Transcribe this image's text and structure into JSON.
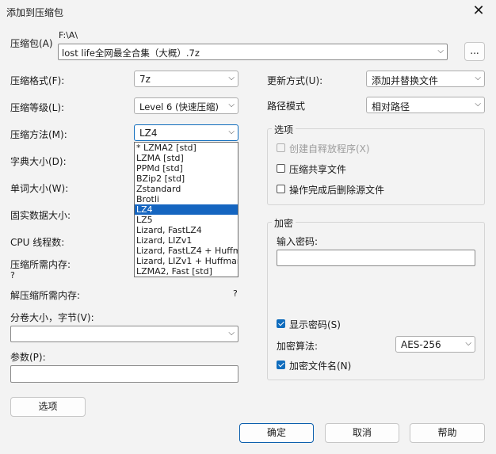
{
  "window": {
    "title": "添加到压缩包"
  },
  "archive": {
    "label": "压缩包(A)",
    "path": "F:\\A\\",
    "filename": "lost life全网最全合集（大概）.7z",
    "browse": "..."
  },
  "left": {
    "format_label": "压缩格式(F):",
    "format_value": "7z",
    "level_label": "压缩等级(L):",
    "level_value": "Level 6 (快速压缩)",
    "method_label": "压缩方法(M):",
    "method_value": "LZ4",
    "dict_label": "字典大小(D):",
    "word_label": "单词大小(W):",
    "solid_label": "固实数据大小:",
    "cpu_label": "CPU 线程数:",
    "memc_label": "压缩所需内存:",
    "memc_value": "?",
    "memd_label": "解压缩所需内存:",
    "memd_value": "?",
    "split_label": "分卷大小，字节(V):",
    "split_value": "",
    "params_label": "参数(P):",
    "params_value": "",
    "options_btn": "选项"
  },
  "method_dropdown": {
    "items": [
      "*  LZMA2 [std]",
      "LZMA [std]",
      "PPMd [std]",
      "BZip2 [std]",
      "Zstandard",
      "Brotli",
      "LZ4",
      "LZ5",
      "Lizard, FastLZ4",
      "Lizard, LIZv1",
      "Lizard, FastLZ4 + Huffman",
      "Lizard, LIZv1 + Huffman",
      "LZMA2, Fast [std]"
    ],
    "selected_index": 6
  },
  "right": {
    "update_label": "更新方式(U):",
    "update_value": "添加并替换文件",
    "path_label": "路径模式",
    "path_value": "相对路径",
    "options_group": "选项",
    "opt_sfx": "创建自释放程序(X)",
    "opt_shared": "压缩共享文件",
    "opt_delete": "操作完成后删除源文件",
    "enc_group": "加密",
    "pwd_label": "输入密码:",
    "pwd_value": "",
    "show_pwd": "显示密码(S)",
    "algo_label": "加密算法:",
    "algo_value": "AES-256",
    "enc_names": "加密文件名(N)"
  },
  "footer": {
    "ok": "确定",
    "cancel": "取消",
    "help": "帮助"
  },
  "colors": {
    "accent": "#0f6cbd",
    "selection": "#1565c0"
  }
}
